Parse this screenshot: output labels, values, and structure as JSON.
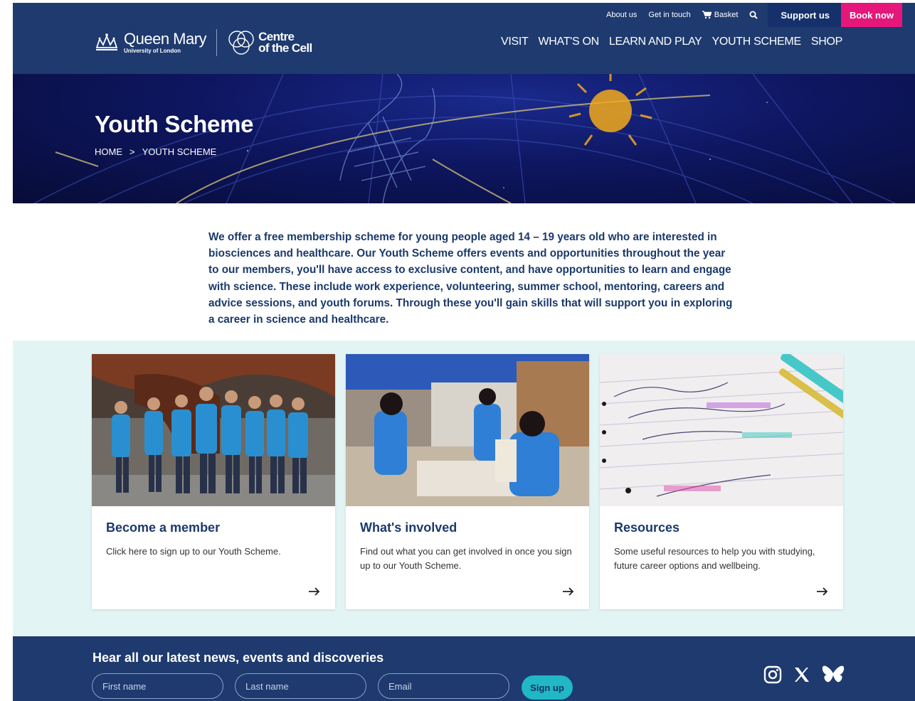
{
  "utility_nav": {
    "about": "About us",
    "contact": "Get in touch",
    "basket": "Basket",
    "support": "Support us",
    "book": "Book now"
  },
  "logos": {
    "qm_name": "Queen Mary",
    "qm_sub": "University of London",
    "cotc_line1": "Centre",
    "cotc_line2": "of the Cell"
  },
  "main_nav": [
    "VISIT",
    "WHAT'S ON",
    "LEARN AND PLAY",
    "YOUTH SCHEME",
    "SHOP"
  ],
  "hero": {
    "title": "Youth Scheme",
    "breadcrumb": {
      "home": "HOME",
      "separator": ">",
      "current": "YOUTH SCHEME"
    }
  },
  "intro": "We offer a free membership scheme for young people aged 14 – 19 years old who are interested in biosciences and healthcare. Our Youth Scheme offers events and opportunities throughout the year to our members, you'll have access to exclusive content, and have opportunities to learn and engage with science. These include work experience, volunteering, summer school, mentoring, careers and advice sessions, and youth forums. Through these you'll gain skills that will support you in exploring a career in science and healthcare.",
  "cards": [
    {
      "title": "Become a member",
      "description": "Click here to sign up to our Youth Scheme."
    },
    {
      "title": "What's involved",
      "description": "Find out what you can get involved in once you sign up to our Youth Scheme."
    },
    {
      "title": "Resources",
      "description": "Some useful resources to help you with studying, future career options and wellbeing."
    }
  ],
  "newsletter": {
    "title": "Hear all our latest news, events and discoveries",
    "first_name_placeholder": "First name",
    "last_name_placeholder": "Last name",
    "email_placeholder": "Email",
    "signup": "Sign up"
  },
  "colors": {
    "navy": "#1e3a6e",
    "pink": "#e6177b",
    "teal": "#1fb8c4",
    "band": "#e3f4f4"
  }
}
